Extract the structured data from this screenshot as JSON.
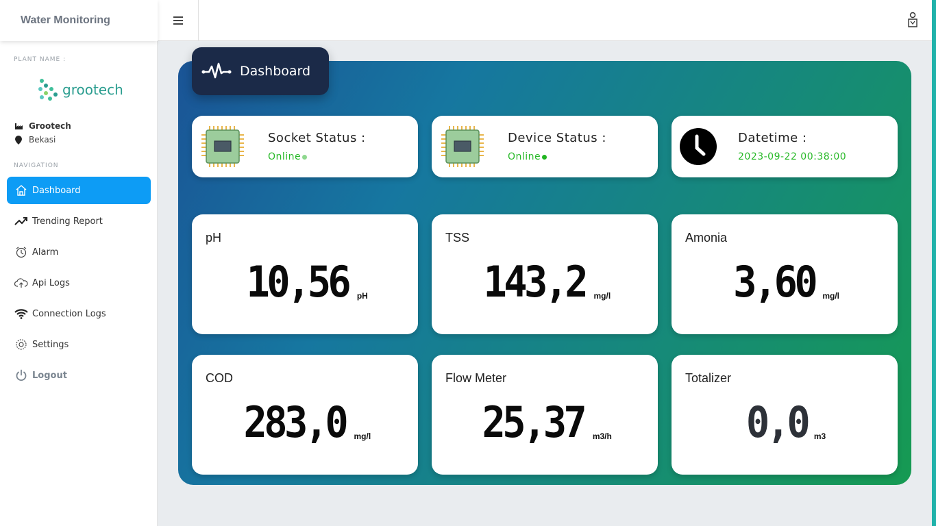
{
  "app": {
    "title": "Water Monitoring"
  },
  "sidebar": {
    "plant_label": "PLANT NAME :",
    "logo_text": "grootech",
    "plant_name": "Grootech",
    "plant_location": "Bekasi",
    "nav_label": "NAVIGATION",
    "items": [
      {
        "label": "Dashboard",
        "icon": "home-icon",
        "active": true
      },
      {
        "label": "Trending Report",
        "icon": "trending-up-icon"
      },
      {
        "label": "Alarm",
        "icon": "alarm-clock-icon"
      },
      {
        "label": "Api Logs",
        "icon": "cloud-upload-icon"
      },
      {
        "label": "Connection Logs",
        "icon": "wifi-icon"
      },
      {
        "label": "Settings",
        "icon": "gear-icon"
      },
      {
        "label": "Logout",
        "icon": "power-icon"
      }
    ]
  },
  "topbar": {
    "menu_icon": "hamburger-icon",
    "user_icon": "user-icon"
  },
  "dashboard": {
    "title": "Dashboard",
    "status": {
      "socket": {
        "label": "Socket Status :",
        "value": "Online",
        "dot_color": "#8fd88f"
      },
      "device": {
        "label": "Device Status :",
        "value": "Online",
        "dot_color": "#21b521"
      },
      "datetime": {
        "label": "Datetime :",
        "value": "2023-09-22 00:38:00"
      }
    },
    "metrics": [
      {
        "label": "pH",
        "value": "10,56",
        "unit": "pH"
      },
      {
        "label": "TSS",
        "value": "143,2",
        "unit": "mg/l"
      },
      {
        "label": "Amonia",
        "value": "3,60",
        "unit": "mg/l"
      },
      {
        "label": "COD",
        "value": "283,0",
        "unit": "mg/l"
      },
      {
        "label": "Flow Meter",
        "value": "25,37",
        "unit": "m3/h"
      },
      {
        "label": "Totalizer",
        "value": "0,0",
        "unit": "m3"
      }
    ]
  },
  "colors": {
    "accent": "#0d9cf5",
    "online": "#28b928",
    "tab_bg": "#1b2a48"
  }
}
